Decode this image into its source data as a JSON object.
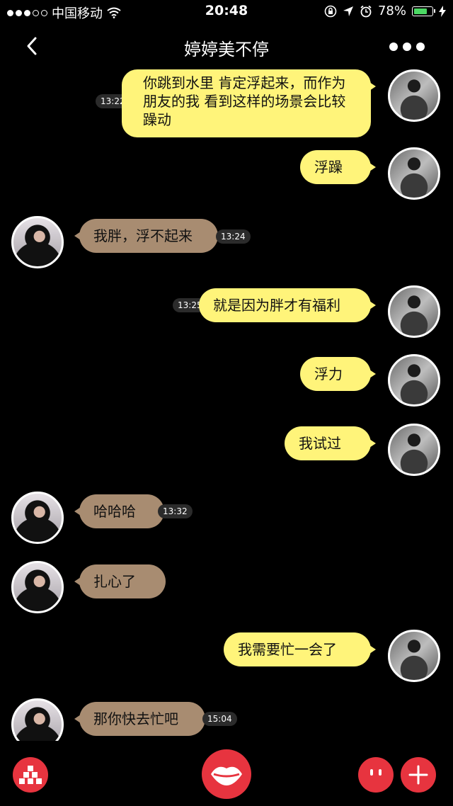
{
  "status_bar": {
    "carrier": "中国移动",
    "time": "20:48",
    "battery": "78%",
    "battery_level": 0.78,
    "icons": [
      "signal-dots-icon",
      "wifi-icon",
      "orientation-lock-icon",
      "location-icon",
      "alarm-icon",
      "battery-icon",
      "charging-icon"
    ]
  },
  "header": {
    "title": "婷婷美不停",
    "back_icon": "chevron-left-icon",
    "more_icon": "more-dots-icon"
  },
  "messages": [
    {
      "from": "me",
      "text": "你跳到水里 肯定浮起来，而作为朋友的我 看到这样的场景会比较躁动",
      "time": "13:22"
    },
    {
      "from": "me",
      "text": "浮躁",
      "time": ""
    },
    {
      "from": "her",
      "text": "我胖，浮不起来",
      "time": "13:24"
    },
    {
      "from": "me",
      "text": "就是因为胖才有福利",
      "time": "13:25"
    },
    {
      "from": "me",
      "text": "浮力",
      "time": ""
    },
    {
      "from": "me",
      "text": "我试过",
      "time": ""
    },
    {
      "from": "her",
      "text": "哈哈哈",
      "time": "13:32"
    },
    {
      "from": "her",
      "text": "扎心了",
      "time": ""
    },
    {
      "from": "me",
      "text": "我需要忙一会了",
      "time": ""
    },
    {
      "from": "her",
      "text": "那你快去忙吧",
      "time": "15:04"
    }
  ],
  "bottom_bar": {
    "buttons": [
      "grid-blocks-icon",
      "lips-icon",
      "face-icon",
      "plus-icon"
    ],
    "accent_color": "#e7343f"
  },
  "colors": {
    "my_bubble": "#fff47a",
    "her_bubble": "#a88c71",
    "background": "#000000"
  }
}
